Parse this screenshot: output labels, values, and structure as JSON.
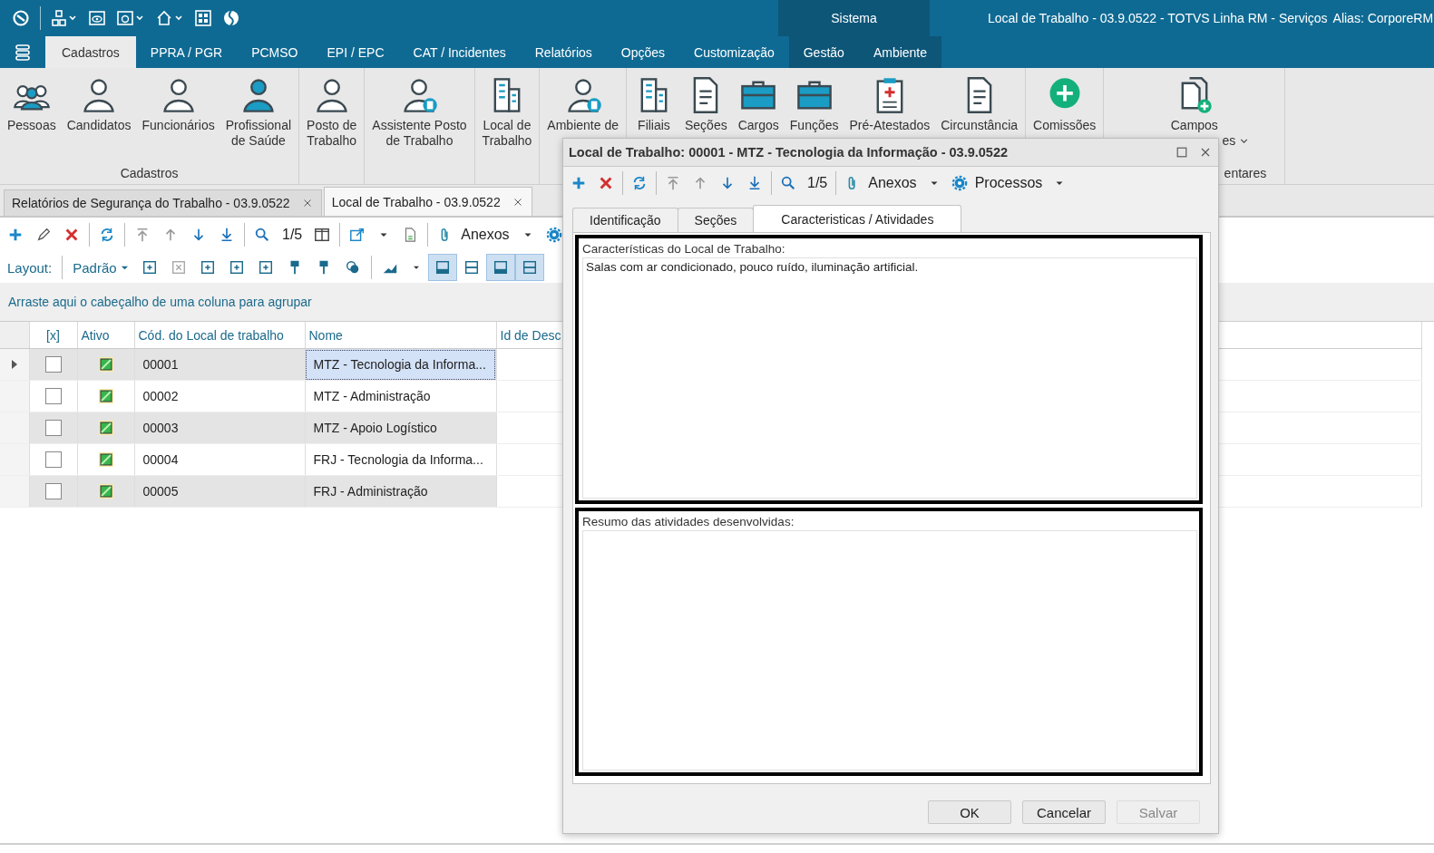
{
  "title_bar": {
    "context": "Sistema",
    "title": "Local de Trabalho - 03.9.0522 - TOTVS Linha RM - Serviços",
    "alias": "Alias: CorporeRM"
  },
  "menu_tabs": [
    {
      "label": "Cadastros",
      "selected": true,
      "contextual": false
    },
    {
      "label": "PPRA / PGR",
      "selected": false,
      "contextual": false
    },
    {
      "label": "PCMSO",
      "selected": false,
      "contextual": false
    },
    {
      "label": "EPI / EPC",
      "selected": false,
      "contextual": false
    },
    {
      "label": "CAT / Incidentes",
      "selected": false,
      "contextual": false
    },
    {
      "label": "Relatórios",
      "selected": false,
      "contextual": false
    },
    {
      "label": "Opções",
      "selected": false,
      "contextual": false
    },
    {
      "label": "Customização",
      "selected": false,
      "contextual": false
    },
    {
      "label": "Gestão",
      "selected": false,
      "contextual": true
    },
    {
      "label": "Ambiente",
      "selected": false,
      "contextual": true
    }
  ],
  "ribbon": {
    "groups": [
      {
        "label": "Cadastros",
        "items": [
          {
            "label": "Pessoas"
          },
          {
            "label": "Candidatos"
          },
          {
            "label": "Funcionários"
          },
          {
            "label": "Profissional\nde Saúde"
          }
        ]
      },
      {
        "items": [
          {
            "label": "Posto de\nTrabalho"
          }
        ]
      },
      {
        "items": [
          {
            "label": "Assistente Posto\nde Trabalho"
          }
        ]
      },
      {
        "items": [
          {
            "label": "Local de\nTrabalho"
          }
        ]
      },
      {
        "items": [
          {
            "label": "Ambiente de"
          }
        ]
      },
      {
        "items": [
          {
            "label": "Filiais"
          },
          {
            "label": "Seções"
          },
          {
            "label": "Cargos"
          },
          {
            "label": "Funções"
          },
          {
            "label": "Pré-Atestados"
          },
          {
            "label": "Circunstância"
          }
        ]
      },
      {
        "items": [
          {
            "label": "Comissões"
          }
        ]
      },
      {
        "label": "entares",
        "items": [
          {
            "label": "Campos",
            "extra": "es"
          }
        ]
      }
    ]
  },
  "document_tabs": [
    {
      "label": "Relatórios de Segurança do Trabalho - 03.9.0522",
      "selected": false
    },
    {
      "label": "Local de Trabalho - 03.9.0522",
      "selected": true
    }
  ],
  "toolbar": {
    "record_position": "1/5",
    "attachments": "Anexos"
  },
  "layout_bar": {
    "label": "Layout:",
    "value": "Padrão"
  },
  "group_panel": {
    "hint": "Arraste aqui o cabeçalho de uma coluna para agrupar"
  },
  "grid": {
    "columns": [
      "[x]",
      "Ativo",
      "Cód. do Local de trabalho",
      "Nome",
      "Id de Desc"
    ],
    "rows": [
      {
        "checked": false,
        "active": true,
        "code": "00001",
        "name": "MTZ - Tecnologia da Informa...",
        "selected": true
      },
      {
        "checked": false,
        "active": true,
        "code": "00002",
        "name": "MTZ - Administração",
        "selected": false
      },
      {
        "checked": false,
        "active": true,
        "code": "00003",
        "name": "MTZ - Apoio Logístico",
        "selected": false
      },
      {
        "checked": false,
        "active": true,
        "code": "00004",
        "name": "FRJ - Tecnologia da Informa...",
        "selected": false
      },
      {
        "checked": false,
        "active": true,
        "code": "00005",
        "name": "FRJ - Administração",
        "selected": false
      }
    ]
  },
  "dialog": {
    "title": "Local de Trabalho: 00001 - MTZ - Tecnologia da Informação - 03.9.0522",
    "record_position": "1/5",
    "attachments": "Anexos",
    "processes": "Processos",
    "tabs": [
      {
        "label": "Identificação",
        "selected": false
      },
      {
        "label": "Seções",
        "selected": false
      },
      {
        "label": "Caracteristicas / Atividades",
        "selected": true
      }
    ],
    "fields": [
      {
        "label": "Características do Local de Trabalho:",
        "value": "Salas com ar condicionado, pouco ruído, iluminação artificial."
      },
      {
        "label": "Resumo das atividades desenvolvidas:"
      }
    ],
    "buttons": [
      {
        "label": "OK",
        "disabled": false
      },
      {
        "label": "Cancelar",
        "disabled": false
      },
      {
        "label": "Salvar",
        "disabled": true
      }
    ]
  }
}
